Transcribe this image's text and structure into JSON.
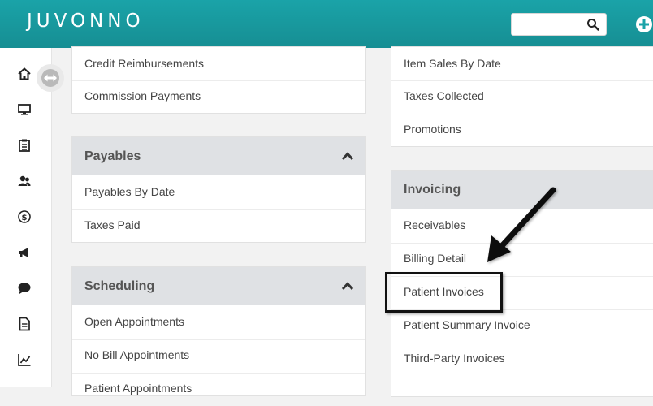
{
  "header": {
    "logo": "JUVONNO",
    "search_value": ""
  },
  "panels": {
    "top_left": {
      "items": [
        "Credit Reimbursements",
        "Commission Payments"
      ]
    },
    "payables": {
      "title": "Payables",
      "items": [
        "Payables By Date",
        "Taxes Paid"
      ]
    },
    "scheduling": {
      "title": "Scheduling",
      "items": [
        "Open Appointments",
        "No Bill Appointments",
        "Patient Appointments"
      ]
    },
    "top_right": {
      "items": [
        "Item Sales By Date",
        "Taxes Collected",
        "Promotions"
      ]
    },
    "invoicing": {
      "title": "Invoicing",
      "items": [
        "Receivables",
        "Billing Detail",
        "Patient Invoices",
        "Patient Summary Invoice",
        "Third-Party Invoices"
      ]
    }
  },
  "sidebar": {
    "icons": [
      "home-icon",
      "monitor-icon",
      "clipboard-icon",
      "users-icon",
      "dollar-icon",
      "megaphone-icon",
      "chat-icon",
      "document-icon",
      "chart-icon"
    ]
  },
  "colors": {
    "header": "#1aa3a8",
    "panel_header": "#dfe1e4",
    "annotation": "#111111"
  }
}
